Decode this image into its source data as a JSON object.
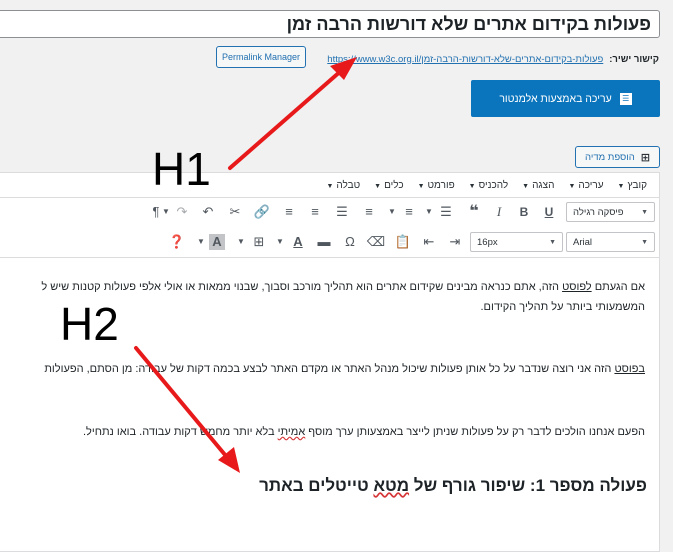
{
  "post": {
    "title": "פעולות בקידום אתרים שלא דורשות הרבה זמן",
    "permalink_label": "קישור ישיר:",
    "permalink_url": "https://www.w3c.org.il/פעולות-בקידום-אתרים-שלא-דורשות-הרבה-זמן",
    "permalink_manager_button": "Permalink Manager"
  },
  "elementor": {
    "button_label": "עריכה באמצעות אלמנטור",
    "icon": "elementor-icon"
  },
  "media": {
    "button_label": "הוספת מדיה",
    "icon": "add-media-icon"
  },
  "menubar": [
    "קובץ",
    "עריכה",
    "הצגה",
    "להכניס",
    "פורמט",
    "כלים",
    "טבלה"
  ],
  "toolbar": {
    "paragraph_select": "פיסקה רגילה",
    "size_select": "16px",
    "font_select": "Arial"
  },
  "content": {
    "p1_line1_a": "אם הגעתם ",
    "p1_line1_link": "לפוסט",
    "p1_line1_b": " הזה, אתם כנראה מבינים שקידום אתרים הוא תהליך מורכב וסבוך, שבנוי ממאות או אולי אלפי פעולות קטנות שיש ל",
    "p1_line2": "המשמעותי ביותר על תהליך הקידום.",
    "p2_link": "בפוסט",
    "p2_b": " הזה אני רוצה שנדבר על כל אותן פעולות שיכול מנהל האתר או מקדם האתר לבצע בכמה דקות של עבודה: מן הסתם, הפעולות",
    "p3_a": "הפעם אנחנו הולכים לדבר רק על פעולות שניתן לייצר באמצעותן ערך מוסף ",
    "p3_spell": "אמיתי",
    "p3_b": " בלא יותר מחמש דקות עבודה. בואו נתחיל.",
    "h2_a": "פעולה מספר 1: שיפור גורף של ",
    "h2_spell": "מטא",
    "h2_b": " טייטלים באתר"
  },
  "annotations": {
    "h1_label": "H1",
    "h2_label": "H2",
    "arrow_color": "#e8191a"
  }
}
